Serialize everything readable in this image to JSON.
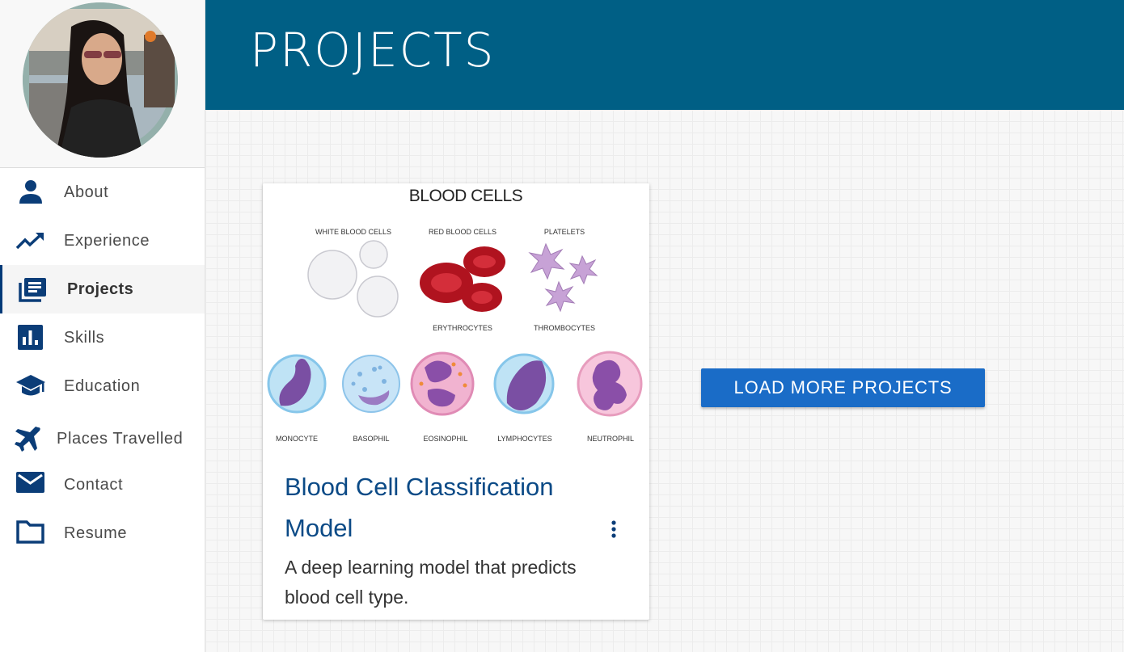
{
  "header": {
    "title": "PROJECTS"
  },
  "sidebar": {
    "items": [
      {
        "label": "About",
        "icon": "person-icon"
      },
      {
        "label": "Experience",
        "icon": "trending-up-icon"
      },
      {
        "label": "Projects",
        "icon": "library-books-icon",
        "active": true
      },
      {
        "label": "Skills",
        "icon": "bar-chart-icon"
      },
      {
        "label": "Education",
        "icon": "graduation-cap-icon"
      },
      {
        "label": "Places Travelled",
        "icon": "airplane-icon"
      },
      {
        "label": "Contact",
        "icon": "mail-icon"
      },
      {
        "label": "Resume",
        "icon": "folder-icon"
      }
    ]
  },
  "project_card": {
    "image": {
      "title": "BLOOD CELLS",
      "top_labels": [
        "WHITE BLOOD CELLS",
        "RED BLOOD CELLS",
        "PLATELETS"
      ],
      "sub_labels": [
        "ERYTHROCYTES",
        "THROMBOCYTES"
      ],
      "cell_labels": [
        "MONOCYTE",
        "BASOPHIL",
        "EOSINOPHIL",
        "LYMPHOCYTES",
        "NEUTROPHIL"
      ]
    },
    "title": "Blood Cell Classification Model",
    "description": "A deep learning model that predicts blood cell type.",
    "menu_icon": "more-vert-icon"
  },
  "load_more": {
    "label": "LOAD MORE PROJECTS"
  },
  "colors": {
    "header_bg": "#005f85",
    "accent_icon": "#0b3d78",
    "title_blue": "#0b4a86",
    "button_bg": "#1a6cc7"
  }
}
